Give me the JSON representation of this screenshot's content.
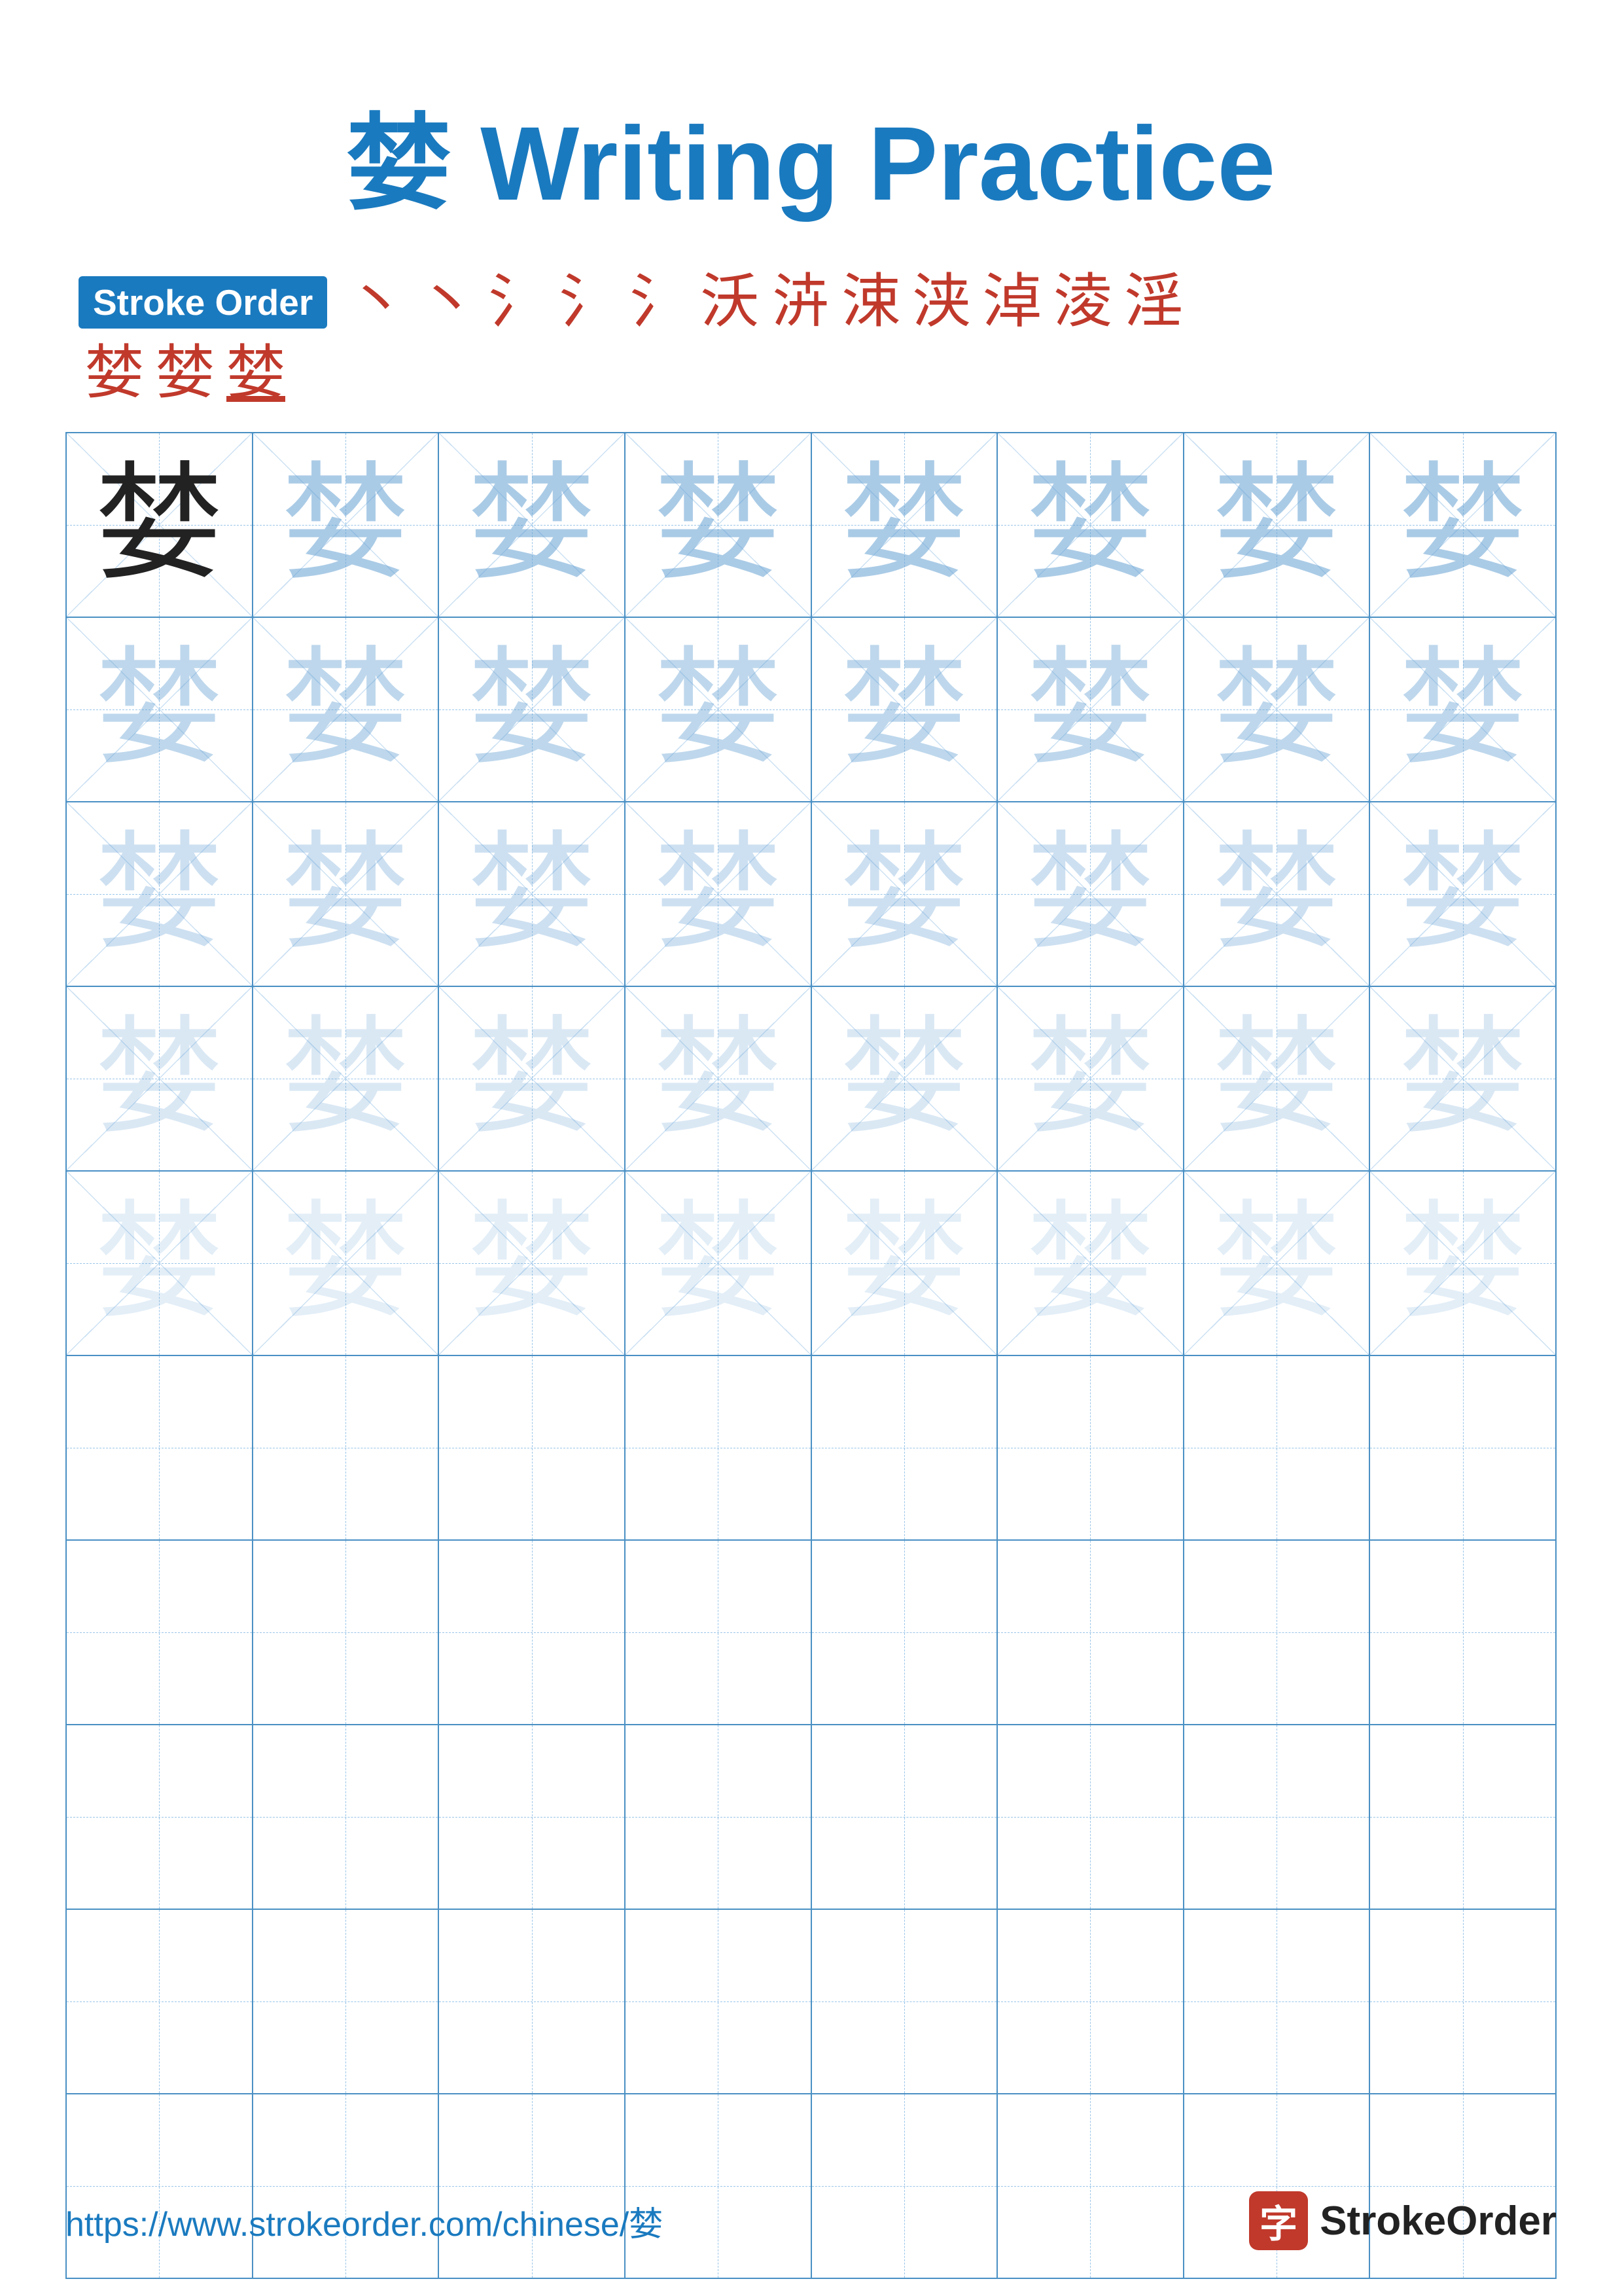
{
  "title": {
    "char": "婪",
    "text": "Writing Practice",
    "full": "婪 Writing Practice"
  },
  "stroke_order": {
    "badge_label": "Stroke Order",
    "strokes_line1": [
      "丶",
      "丶",
      "氵",
      "氵",
      "氵",
      "沃",
      "泋",
      "涑",
      "浃",
      "淖",
      "淩",
      "淫"
    ],
    "strokes_line2": [
      "婪",
      "婪",
      "婪"
    ]
  },
  "practice": {
    "char": "婪",
    "rows": 10,
    "cols": 8,
    "filled_rows": 5
  },
  "footer": {
    "url": "https://www.strokeorder.com/chinese/婪",
    "logo_char": "字",
    "brand": "StrokeOrder"
  }
}
